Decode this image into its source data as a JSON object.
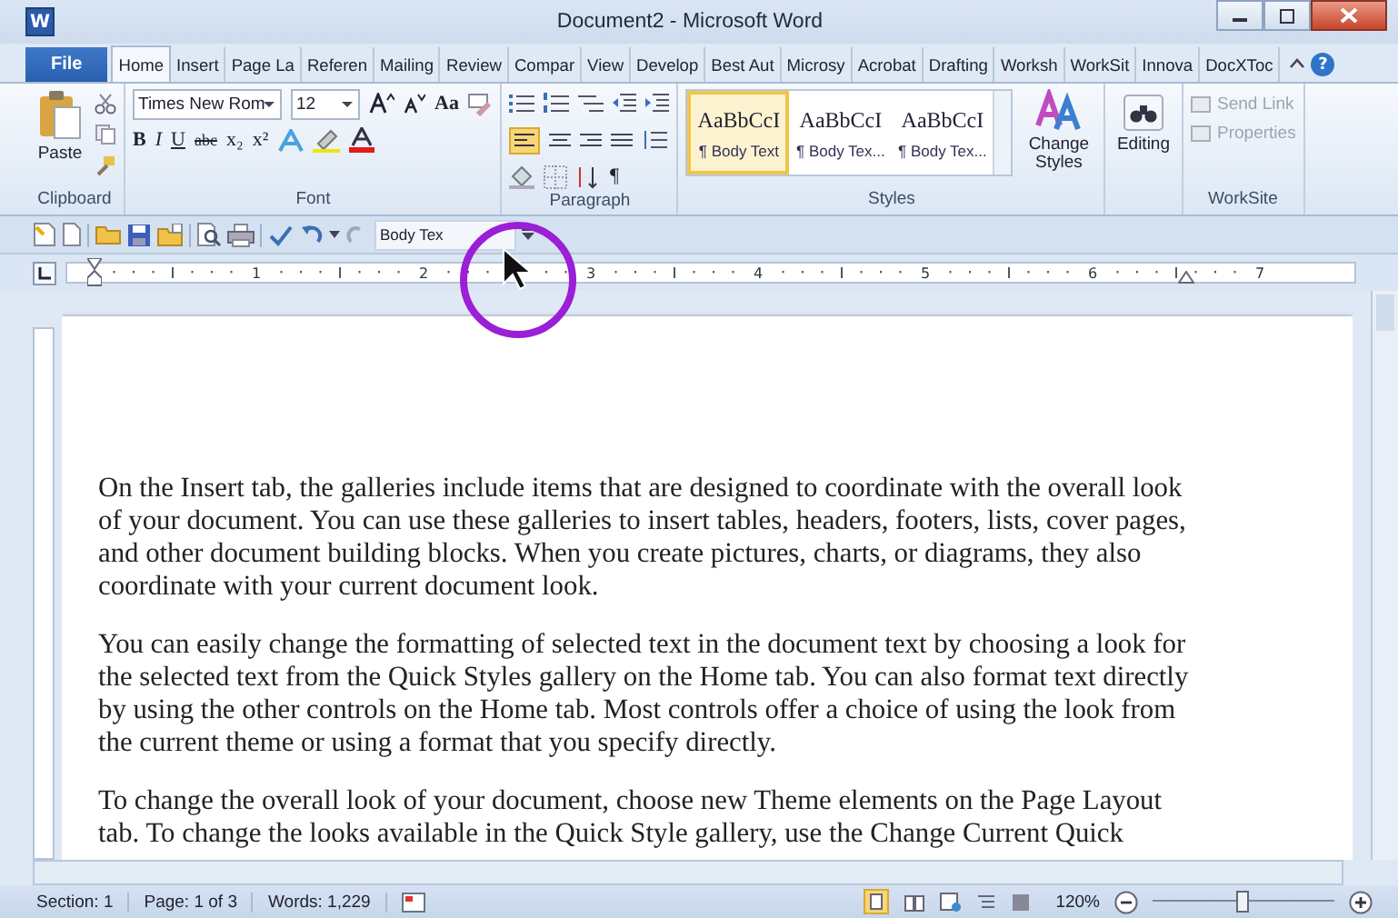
{
  "window": {
    "app_glyph": "W",
    "title": "Document2 - Microsoft Word"
  },
  "tabs": [
    {
      "label": "File",
      "kind": "file",
      "selected": false
    },
    {
      "label": "Home",
      "kind": "tab",
      "selected": true
    },
    {
      "label": "Insert",
      "kind": "tab",
      "selected": false
    },
    {
      "label": "Page La",
      "kind": "tab",
      "selected": false
    },
    {
      "label": "Referen",
      "kind": "tab",
      "selected": false
    },
    {
      "label": "Mailing",
      "kind": "tab",
      "selected": false
    },
    {
      "label": "Review",
      "kind": "tab",
      "selected": false
    },
    {
      "label": "Compar",
      "kind": "tab",
      "selected": false
    },
    {
      "label": "View",
      "kind": "tab",
      "selected": false
    },
    {
      "label": "Develop",
      "kind": "tab",
      "selected": false
    },
    {
      "label": "Best Aut",
      "kind": "tab",
      "selected": false
    },
    {
      "label": "Microsy",
      "kind": "tab",
      "selected": false
    },
    {
      "label": "Acrobat",
      "kind": "tab",
      "selected": false
    },
    {
      "label": "Drafting",
      "kind": "tab",
      "selected": false
    },
    {
      "label": "Worksh",
      "kind": "tab",
      "selected": false
    },
    {
      "label": "WorkSit",
      "kind": "tab",
      "selected": false
    },
    {
      "label": "Innova",
      "kind": "tab",
      "selected": false
    },
    {
      "label": "DocXToc",
      "kind": "tab",
      "selected": false
    }
  ],
  "help_glyph": "?",
  "ribbon": {
    "clipboard": {
      "label": "Clipboard",
      "paste": "Paste"
    },
    "font": {
      "label": "Font",
      "name": "Times New Rom",
      "size": "12",
      "case_button": "Aa",
      "buttons": [
        "B",
        "I",
        "U",
        "abc",
        "x₂",
        "x²"
      ]
    },
    "paragraph": {
      "label": "Paragraph",
      "pilcrow": "¶"
    },
    "styles": {
      "label": "Styles",
      "items": [
        {
          "preview": "AaBbCcI",
          "name": "¶ Body Text",
          "selected": true
        },
        {
          "preview": "AaBbCcI",
          "name": "¶ Body Tex...",
          "selected": false
        },
        {
          "preview": "AaBbCcI",
          "name": "¶ Body Tex...",
          "selected": false
        }
      ],
      "change_styles": "Change Styles"
    },
    "editing": {
      "label": "Editing"
    },
    "worksite": {
      "label": "WorkSite",
      "items": [
        {
          "label": "Send Link",
          "disabled": true
        },
        {
          "label": "Properties",
          "disabled": true
        }
      ]
    }
  },
  "quick_access": {
    "style_box": "Body Tex"
  },
  "ruler": {
    "numbers": [
      "1",
      "2",
      "3",
      "4",
      "5",
      "6",
      "7"
    ]
  },
  "document": {
    "paragraphs": [
      "On the Insert tab, the galleries include items that are designed to coordinate with the overall look of your document. You can use these galleries to insert tables, headers, footers, lists, cover pages, and other document building blocks. When you create pictures, charts, or diagrams, they also coordinate with your current document look.",
      "You can easily change the formatting of selected text in the document text by choosing a look for the selected text from the Quick Styles gallery on the Home tab. You can also format text directly by using the other controls on the Home tab. Most controls offer a choice of using the look from the current theme or using a format that you specify directly.",
      "To change the overall look of your document, choose new Theme elements on the Page Layout tab. To change the looks available in the Quick Style gallery, use the Change Current Quick"
    ]
  },
  "status_bar": {
    "section": "Section: 1",
    "page": "Page: 1 of 3",
    "words": "Words: 1,229",
    "zoom": "120%",
    "zoom_slider": {
      "level": 0.5
    }
  }
}
